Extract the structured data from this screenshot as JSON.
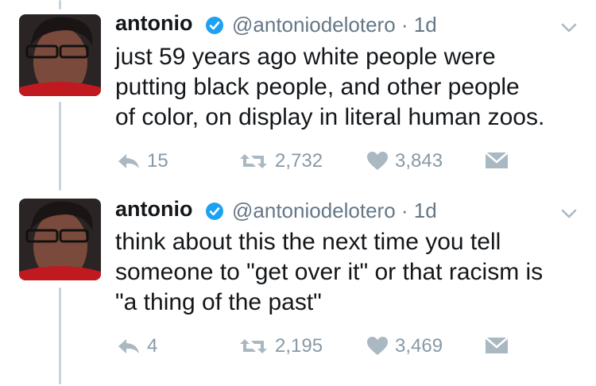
{
  "tweets": [
    {
      "name": "antonio",
      "handle": "@antoniodelotero",
      "time": "· 1d",
      "text": "just 59 years ago white people were\nputting black people, and other people\nof color, on display in literal human zoos.",
      "replies": "15",
      "retweets": "2,732",
      "likes": "3,843"
    },
    {
      "name": "antonio",
      "handle": "@antoniodelotero",
      "time": "· 1d",
      "text": "think about this the next time you tell\nsomeone to \"get over it\" or that racism is\n\"a thing of the past\"",
      "replies": "4",
      "retweets": "2,195",
      "likes": "3,469"
    }
  ],
  "icons": {
    "reply": "reply-icon",
    "retweet": "retweet-icon",
    "like": "heart-icon",
    "dm": "envelope-icon",
    "verified": "verified-badge-icon",
    "menu": "chevron-down-icon"
  },
  "colors": {
    "icon_gray": "#aab8c2",
    "verified_blue": "#1da1f2",
    "thread_line": "#c9d3db"
  }
}
